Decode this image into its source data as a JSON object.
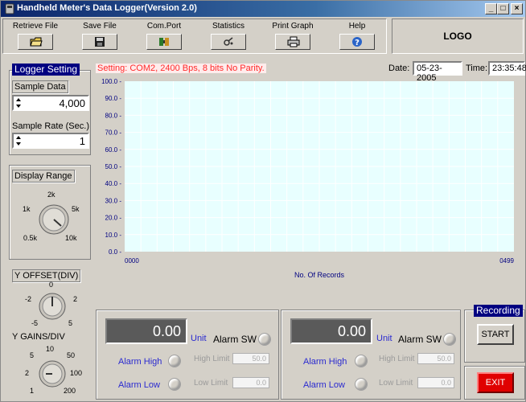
{
  "window": {
    "title": "Handheld Meter's Data Logger(Version 2.0)",
    "controls": {
      "minimize": "_",
      "maximize": "□",
      "close": "×"
    }
  },
  "toolbar": {
    "items": [
      {
        "label": "Retrieve File",
        "icon": "open-folder-icon"
      },
      {
        "label": "Save File",
        "icon": "floppy-disk-icon"
      },
      {
        "label": "Com.Port",
        "icon": "port-connector-icon"
      },
      {
        "label": "Statistics",
        "icon": "statistics-icon"
      },
      {
        "label": "Print Graph",
        "icon": "printer-icon"
      },
      {
        "label": "Help",
        "icon": "help-icon"
      }
    ]
  },
  "logo": {
    "text": "LOGO"
  },
  "logger": {
    "title": "Logger Setting",
    "sample_data_label": "Sample Data",
    "sample_data_value": "4,000",
    "sample_rate_label": "Sample Rate (Sec.)",
    "sample_rate_value": "1"
  },
  "status": {
    "setting": "Setting: COM2, 2400 Bps, 8 bits No Parity.",
    "date_label": "Date:",
    "date_value": "05-23-2005",
    "time_label": "Time:",
    "time_value": "23:35:48"
  },
  "display_range": {
    "label": "Display Range",
    "ticks": [
      "2k",
      "1k",
      "5k",
      "0.5k",
      "10k"
    ]
  },
  "y_offset": {
    "label": "Y OFFSET(DIV)",
    "ticks": [
      "0",
      "-2",
      "2",
      "-5",
      "5"
    ]
  },
  "y_gains": {
    "label": "Y GAINS/DIV",
    "ticks": [
      "10",
      "5",
      "50",
      "2",
      "100",
      "1",
      "200"
    ]
  },
  "chart_data": {
    "type": "line",
    "title": "",
    "xlabel": "No. Of Records",
    "ylabel": "",
    "y_ticks": [
      "100.0",
      "90.0",
      "80.0",
      "70.0",
      "60.0",
      "50.0",
      "40.0",
      "30.0",
      "20.0",
      "10.0",
      "0.0"
    ],
    "x_ticks": [
      "0000",
      "0499"
    ],
    "ylim": [
      0,
      100
    ],
    "xlim": [
      0,
      499
    ],
    "grid": true,
    "background": "#e8ffff",
    "grid_color": "#ffffff",
    "series": []
  },
  "channel1": {
    "value": "0.00",
    "unit": "Unit",
    "alarm_sw": "Alarm SW",
    "alarm_high": "Alarm High",
    "alarm_low": "Alarm Low",
    "high_limit_label": "High Limit",
    "high_limit_value": "50.0",
    "low_limit_label": "Low Limit",
    "low_limit_value": "0.0"
  },
  "channel2": {
    "value": "0.00",
    "unit": "Unit",
    "alarm_sw": "Alarm SW",
    "alarm_high": "Alarm High",
    "alarm_low": "Alarm Low",
    "high_limit_label": "High Limit",
    "high_limit_value": "50.0",
    "low_limit_label": "Low Limit",
    "low_limit_value": "0.0"
  },
  "recording": {
    "title": "Recording",
    "start_label": "START",
    "exit_label": "EXIT"
  },
  "colors": {
    "title_blue": "#000080",
    "status_red": "#ff2a2a",
    "exit_red": "#e00000",
    "chart_bg": "#e8ffff"
  }
}
